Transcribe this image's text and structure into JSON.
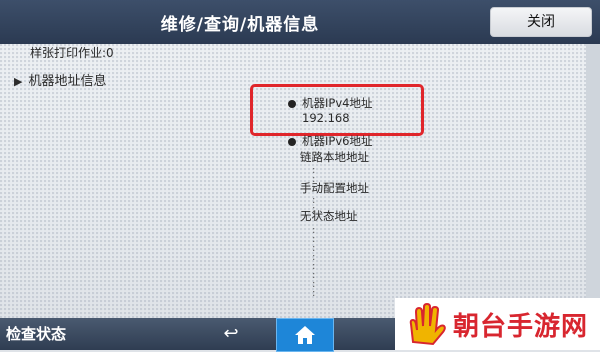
{
  "window": {
    "title": "维修/查询/机器信息",
    "close_label": "关闭"
  },
  "content": {
    "sample_jobs": "样张打印作业:0",
    "address_info": "机器地址信息",
    "ipv4": {
      "label": "机器IPv4地址",
      "value": "192.168"
    },
    "ipv6": {
      "label": "机器IPv6地址",
      "link_local": "链路本地地址",
      "manual": "手动配置地址",
      "stateless": "无状态地址"
    }
  },
  "bottom_bar": {
    "status_label": "检查状态"
  },
  "watermark": {
    "text": "朝台手游网"
  },
  "colors": {
    "title_bar": "#2b3a52",
    "highlight": "#e0262b",
    "home_button": "#1e86d8",
    "watermark_text": "#d8262f"
  }
}
